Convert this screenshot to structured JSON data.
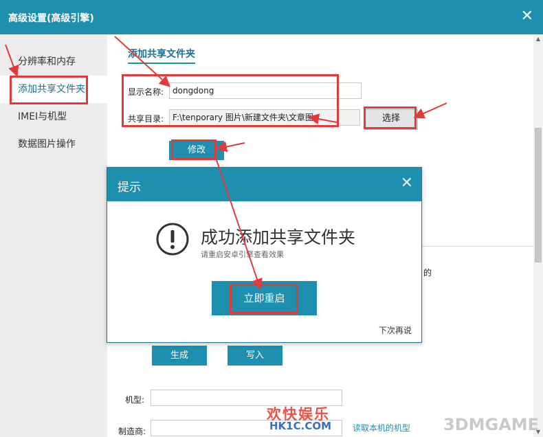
{
  "window": {
    "title": "高级设置(高级引擎)"
  },
  "sidebar": {
    "items": [
      {
        "label": "分辨率和内存"
      },
      {
        "label": "添加共享文件夹"
      },
      {
        "label": "IMEI与机型"
      },
      {
        "label": "数据图片操作"
      }
    ]
  },
  "share_section": {
    "title": "添加共享文件夹",
    "display_name_label": "显示名称:",
    "display_name_value": "dongdong",
    "share_dir_label": "共享目录:",
    "share_dir_value": "F:\\tenporary 图片\\新建文件夹\\文章图",
    "choose_button": "选择",
    "modify_button": "修改"
  },
  "imei_section": {
    "partial_text": "的",
    "generate_button": "生成",
    "write_button": "写入",
    "model_label": "机型:",
    "model_value": "",
    "maker_label": "制造商:",
    "maker_value": "",
    "read_model_link": "读取本机的机型"
  },
  "dialog": {
    "title": "提示",
    "message": "成功添加共享文件夹",
    "submessage": "请重启安卓引擎查看效果",
    "restart_button": "立即重启",
    "later_link": "下次再说"
  },
  "watermarks": {
    "left_main": "欢快娱乐",
    "left_sub": "HK1C.COM",
    "right": "3DMGAME"
  },
  "colors": {
    "accent": "#1e8faf",
    "annotation": "#e23a3a",
    "sidebar_bg": "#ececec",
    "section_title": "#1e6f90"
  }
}
